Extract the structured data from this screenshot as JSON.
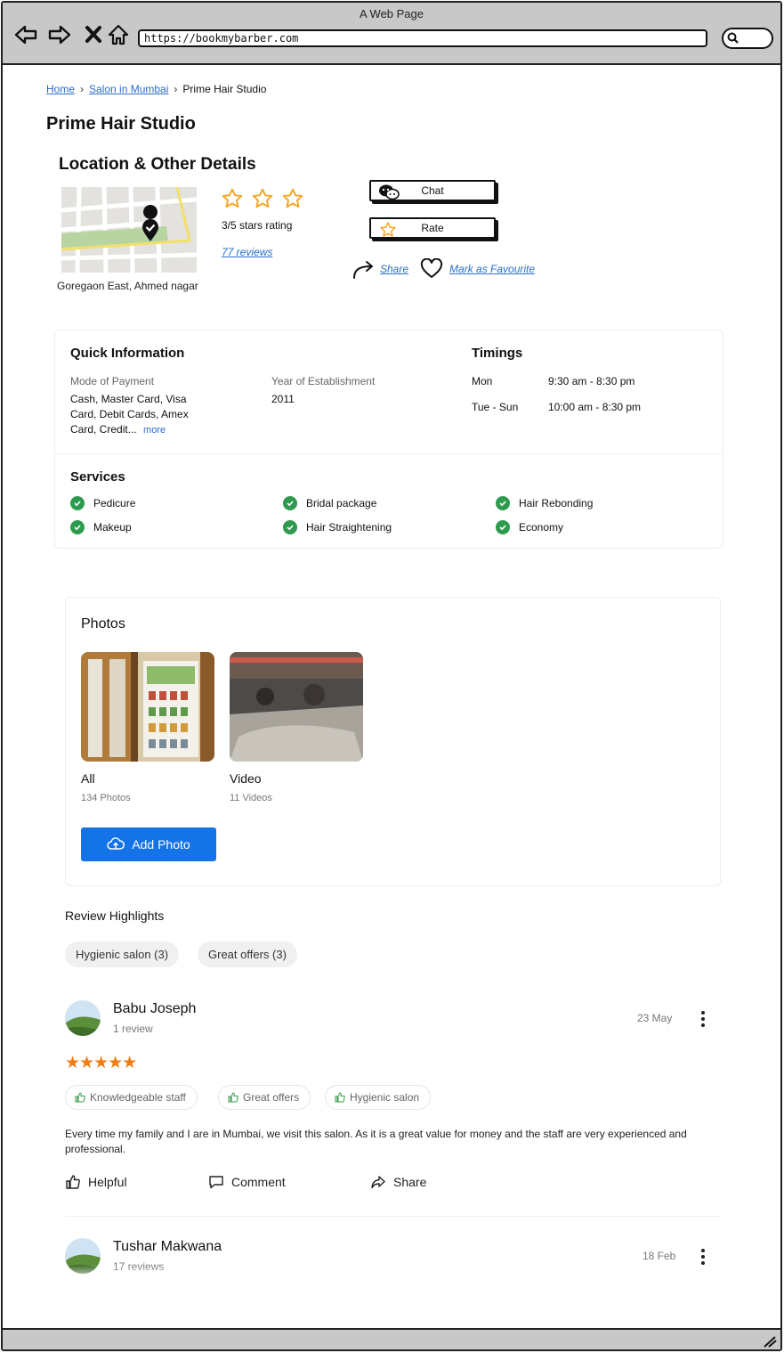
{
  "browser": {
    "window_title": "A Web Page",
    "url": "https://bookmybarber.com"
  },
  "breadcrumb": {
    "home": "Home",
    "city": "Salon in Mumbai",
    "current": "Prime Hair Studio",
    "separator": "›"
  },
  "page_title": "Prime Hair Studio",
  "location": {
    "section_title": "Location & Other Details",
    "address": "Goregaon East, Ahmed nagar",
    "rating_text": "3/5 stars rating",
    "reviews_link": "77 reviews",
    "star_count": 3,
    "star_color": "#f5a623"
  },
  "actions": {
    "chat": "Chat",
    "rate": "Rate",
    "share": "Share",
    "favourite": "Mark as Favourite"
  },
  "quick_info": {
    "title": "Quick Information",
    "payment_label": "Mode of Payment",
    "payment_lines": [
      "Cash, Master Card, Visa",
      "Card, Debit Cards, Amex",
      "Card, Credit..."
    ],
    "more": "more",
    "established_label": "Year of Establishment",
    "established_value": "2011",
    "timings_title": "Timings",
    "timings": [
      {
        "day": "Mon",
        "hours": "9:30 am - 8:30 pm"
      },
      {
        "day": "Tue - Sun",
        "hours": "10:00 am - 8:30 pm"
      }
    ]
  },
  "services": {
    "title": "Services",
    "items": [
      "Pedicure",
      "Bridal package",
      "Hair Rebonding",
      "Makeup",
      "Hair Straightening",
      "Economy"
    ],
    "check_color": "#2e9a4e"
  },
  "photos": {
    "title": "Photos",
    "albums": [
      {
        "name": "All",
        "count": "134 Photos"
      },
      {
        "name": "Video",
        "count": "11 Videos"
      }
    ],
    "add_button": "Add Photo",
    "button_color": "#1473e6"
  },
  "reviews": {
    "title": "Review Highlights",
    "chips": [
      "Hygienic salon (3)",
      "Great offers (3)"
    ],
    "items": [
      {
        "name": "Babu Joseph",
        "sub": "1 review",
        "date": "23 May",
        "stars": "★★★★★",
        "tags": [
          "Knowledgeable staff",
          "Great offers",
          "Hygienic salon"
        ],
        "text": "Every time my family and I are in Mumbai, we visit this salon. As it is a great value for money and the staff are very experienced and professional.",
        "actions": [
          "Helpful",
          "Comment",
          "Share"
        ]
      },
      {
        "name": "Tushar Makwana",
        "sub": "17 reviews",
        "date": "18 Feb"
      }
    ]
  }
}
